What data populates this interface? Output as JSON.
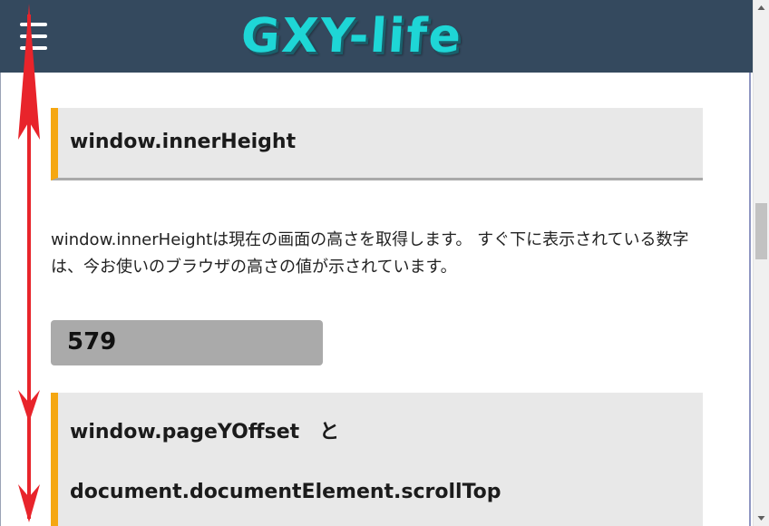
{
  "header": {
    "logo_text": "GXY-life",
    "menu_icon": "hamburger-menu-icon",
    "background_color": "#34495e",
    "logo_color": "#1ed6d6"
  },
  "section1": {
    "heading": "window.innerHeight",
    "paragraph": "window.innerHeightは現在の画面の高さを取得します。 すぐ下に表示されている数字は、今お使いのブラウザの高さの値が示されています。",
    "value": "579"
  },
  "section2": {
    "heading_line1": "window.pageYOffset　と",
    "heading_line2": "document.documentElement.scrollTop"
  },
  "colors": {
    "accent_border": "#f5a712",
    "heading_bg": "#e8e8e8",
    "value_bg": "#aaaaaa",
    "annotation": "#e8242b"
  },
  "scrollbar": {
    "up_icon": "scroll-up-arrow-icon",
    "down_icon": "scroll-down-arrow-icon"
  }
}
